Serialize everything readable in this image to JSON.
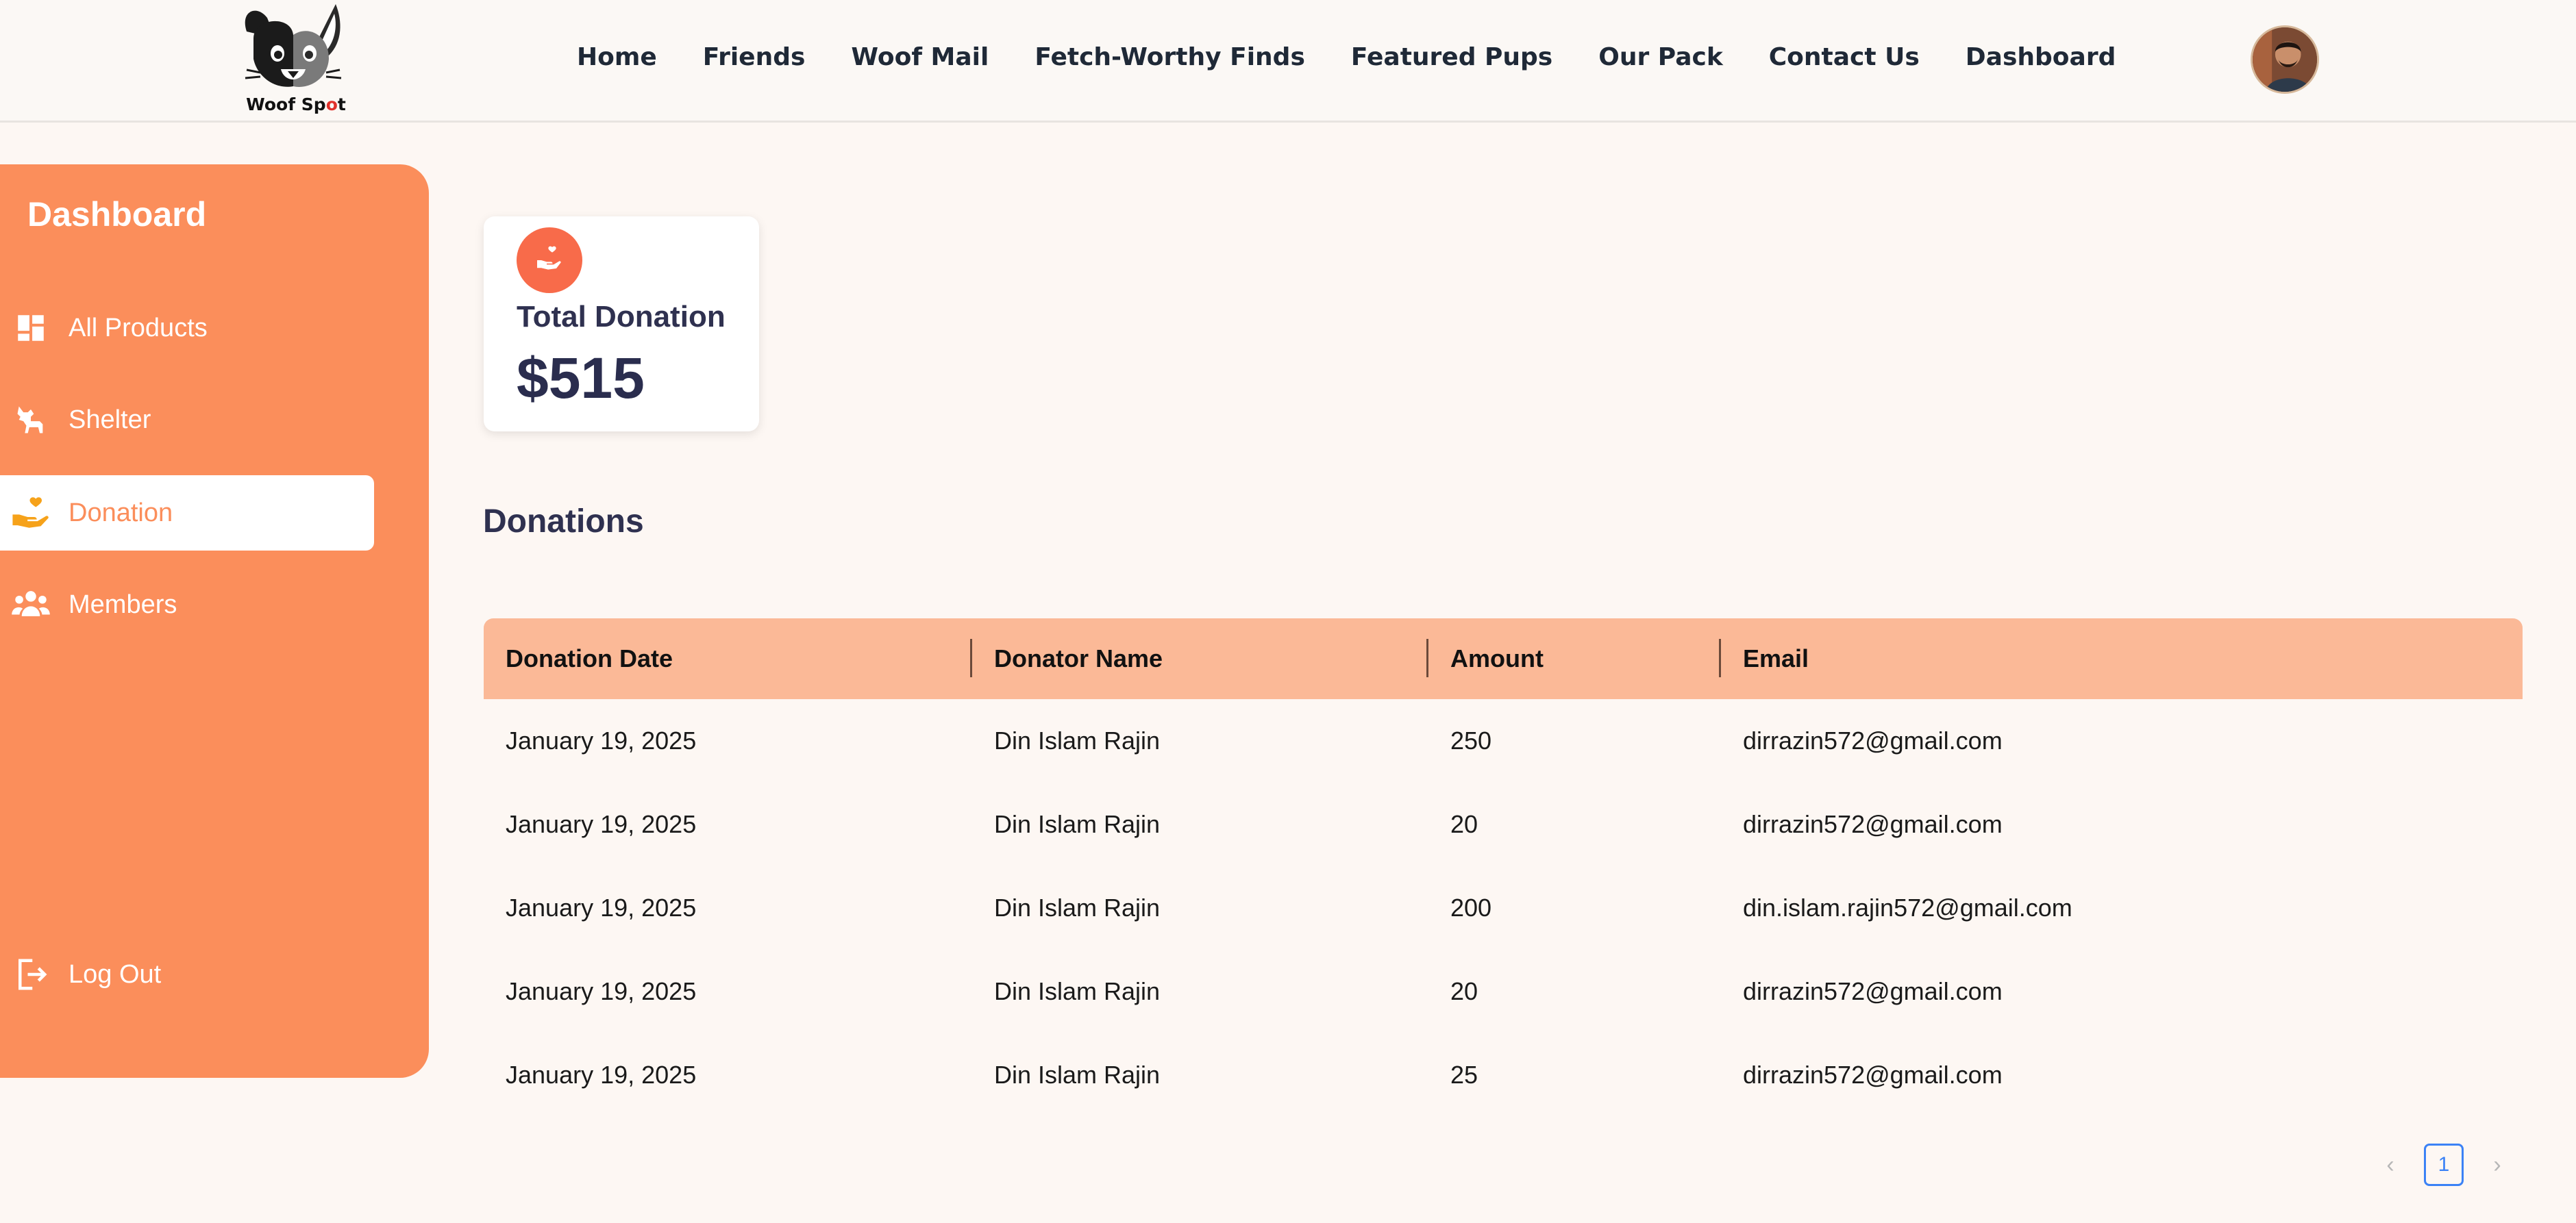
{
  "header": {
    "logo_text": "Woof Sp",
    "logo_pin": "o",
    "logo_tail": "t",
    "nav": [
      {
        "label": "Home"
      },
      {
        "label": "Friends"
      },
      {
        "label": "Woof Mail"
      },
      {
        "label": "Fetch-Worthy Finds"
      },
      {
        "label": "Featured Pups"
      },
      {
        "label": "Our Pack"
      },
      {
        "label": "Contact Us"
      },
      {
        "label": "Dashboard"
      }
    ]
  },
  "sidebar": {
    "title": "Dashboard",
    "items": [
      {
        "label": "All Products",
        "icon": "dashboard-grid-icon"
      },
      {
        "label": "Shelter",
        "icon": "dog-icon"
      },
      {
        "label": "Donation",
        "icon": "hand-heart-icon",
        "active": true
      },
      {
        "label": "Members",
        "icon": "users-icon"
      }
    ],
    "logout_label": "Log Out"
  },
  "stat": {
    "label": "Total Donation",
    "value": "$515"
  },
  "donations": {
    "title": "Donations",
    "columns": [
      "Donation Date",
      "Donator Name",
      "Amount",
      "Email"
    ],
    "rows": [
      {
        "date": "January 19, 2025",
        "name": "Din Islam Rajin",
        "amount": "250",
        "email": "dirrazin572@gmail.com"
      },
      {
        "date": "January 19, 2025",
        "name": "Din Islam Rajin",
        "amount": "20",
        "email": "dirrazin572@gmail.com"
      },
      {
        "date": "January 19, 2025",
        "name": "Din Islam Rajin",
        "amount": "200",
        "email": "din.islam.rajin572@gmail.com"
      },
      {
        "date": "January 19, 2025",
        "name": "Din Islam Rajin",
        "amount": "20",
        "email": "dirrazin572@gmail.com"
      },
      {
        "date": "January 19, 2025",
        "name": "Din Islam Rajin",
        "amount": "25",
        "email": "dirrazin572@gmail.com"
      }
    ]
  },
  "pagination": {
    "current": "1",
    "prev": "‹",
    "next": "›"
  },
  "colors": {
    "sidebar": "#fb8e5b",
    "table_header": "#fbb997",
    "accent": "#f86b4a",
    "page_bg": "#fdf7f3"
  }
}
